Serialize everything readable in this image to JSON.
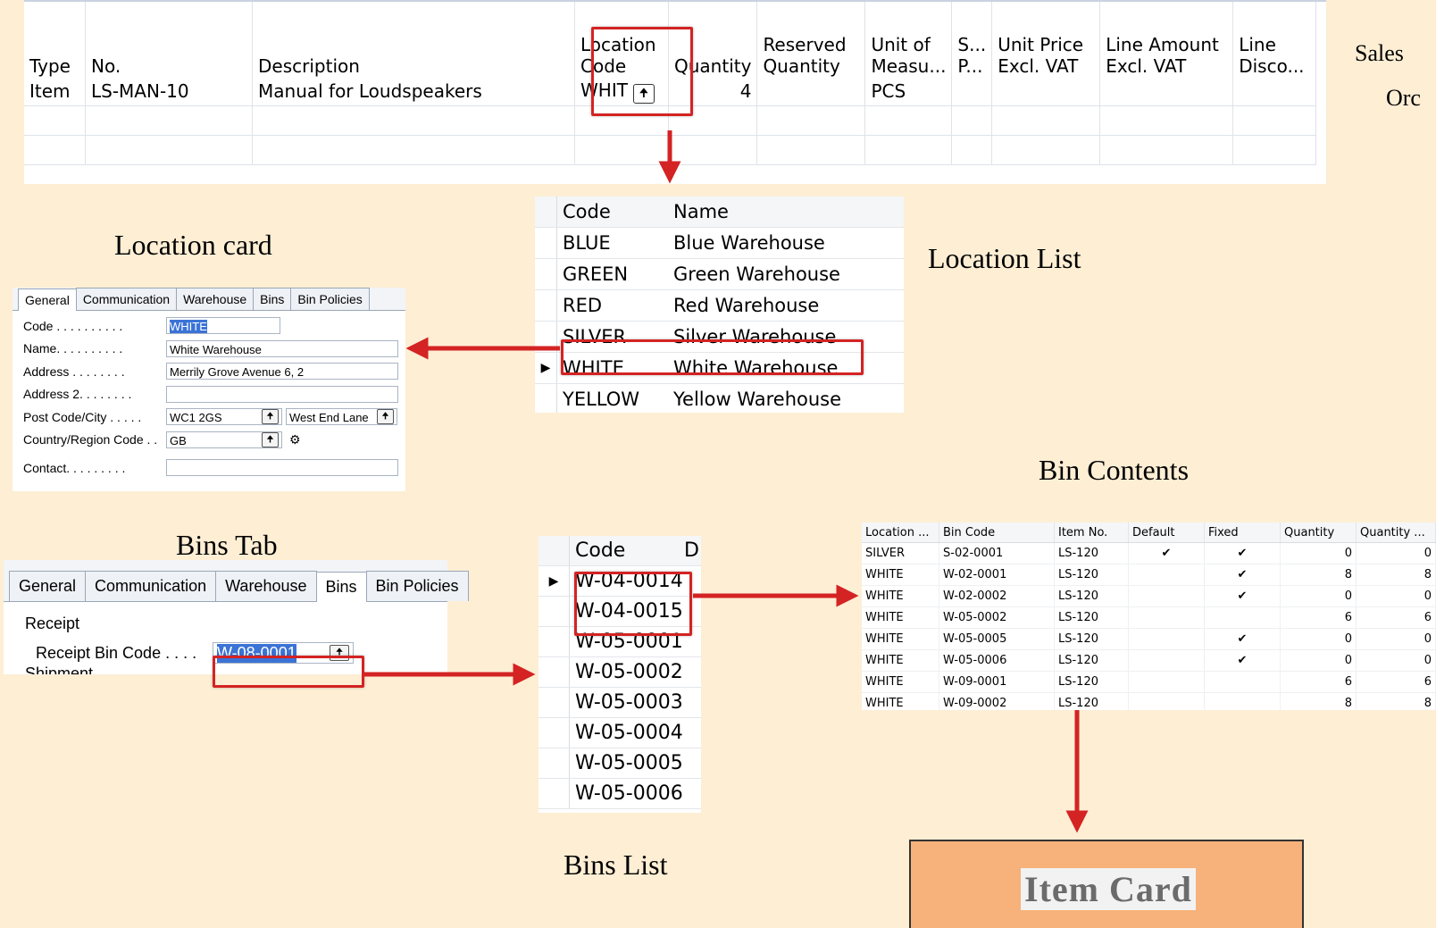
{
  "sales_order": {
    "side_label_1": "Sales",
    "side_label_2": "Orc",
    "headers": [
      [
        "",
        "Type"
      ],
      [
        "",
        "No."
      ],
      [
        "",
        "Description"
      ],
      [
        "Location",
        "Code"
      ],
      [
        "",
        "Quantity"
      ],
      [
        "Reserved",
        "Quantity"
      ],
      [
        "Unit of",
        "Measu..."
      ],
      [
        "S...",
        "P..."
      ],
      [
        "Unit Price",
        "Excl. VAT"
      ],
      [
        "Line Amount",
        "Excl. VAT"
      ],
      [
        "Line",
        "Disco..."
      ]
    ],
    "row": {
      "type": "Item",
      "no": "LS-MAN-10",
      "description": "Manual for Loudspeakers",
      "location_code": "WHIT",
      "quantity": "4",
      "unit": "PCS"
    }
  },
  "labels": {
    "location_card": "Location card",
    "location_list": "Location List",
    "bin_contents": "Bin Contents",
    "bins_tab": "Bins Tab",
    "bins_list": "Bins List",
    "item_card": "Item Card"
  },
  "location_list": {
    "headers": {
      "code": "Code",
      "name": "Name"
    },
    "rows": [
      {
        "code": "BLUE",
        "name": "Blue Warehouse"
      },
      {
        "code": "GREEN",
        "name": "Green Warehouse"
      },
      {
        "code": "RED",
        "name": "Red Warehouse"
      },
      {
        "code": "SILVER",
        "name": "Silver Warehouse"
      },
      {
        "code": "WHITE",
        "name": "White Warehouse"
      },
      {
        "code": "YELLOW",
        "name": "Yellow Warehouse"
      }
    ]
  },
  "location_card": {
    "tabs": [
      "General",
      "Communication",
      "Warehouse",
      "Bins",
      "Bin Policies"
    ],
    "fields": {
      "code_label": "Code . . . . . . . . . .",
      "code": "WHITE",
      "name_label": "Name. . . . . . . . . .",
      "name": "White Warehouse",
      "address_label": "Address . . . . . . . .",
      "address": "Merrily Grove Avenue 6, 2",
      "address2_label": "Address 2. . . . . . . .",
      "address2": "",
      "postcode_label": "Post Code/City . . . . .",
      "postcode": "WC1 2GS",
      "city": "West End Lane",
      "country_label": "Country/Region Code . .",
      "country": "GB",
      "contact_label": "Contact. . . . . . . . .",
      "contact": ""
    }
  },
  "bins_tab": {
    "tabs": [
      "General",
      "Communication",
      "Warehouse",
      "Bins",
      "Bin Policies"
    ],
    "section": "Receipt",
    "receipt_bin_label": "Receipt Bin Code . . . .",
    "receipt_bin_value": "W-08-0001",
    "cut_off_text": "Shipment"
  },
  "bins_list": {
    "header": "Code",
    "header_cut": "D",
    "rows": [
      "W-04-0014",
      "W-04-0015",
      "W-05-0001",
      "W-05-0002",
      "W-05-0003",
      "W-05-0004",
      "W-05-0005",
      "W-05-0006"
    ]
  },
  "bin_contents": {
    "headers": [
      "Location ...",
      "Bin Code",
      "Item No.",
      "Default",
      "Fixed",
      "Quantity",
      "Quantity ..."
    ],
    "rows": [
      [
        "SILVER",
        "S-02-0001",
        "LS-120",
        "✔",
        "✔",
        "0",
        "0"
      ],
      [
        "WHITE",
        "W-02-0001",
        "LS-120",
        "",
        "✔",
        "8",
        "8"
      ],
      [
        "WHITE",
        "W-02-0002",
        "LS-120",
        "",
        "✔",
        "0",
        "0"
      ],
      [
        "WHITE",
        "W-05-0002",
        "LS-120",
        "",
        "",
        "6",
        "6"
      ],
      [
        "WHITE",
        "W-05-0005",
        "LS-120",
        "",
        "✔",
        "0",
        "0"
      ],
      [
        "WHITE",
        "W-05-0006",
        "LS-120",
        "",
        "✔",
        "0",
        "0"
      ],
      [
        "WHITE",
        "W-09-0001",
        "LS-120",
        "",
        "",
        "6",
        "6"
      ],
      [
        "WHITE",
        "W-09-0002",
        "LS-120",
        "",
        "",
        "8",
        "8"
      ]
    ]
  },
  "colors": {
    "background": "#fdeed4",
    "highlight_red": "#d42323",
    "item_card_fill": "#f6b27a",
    "selection_blue": "#3b73d6"
  }
}
